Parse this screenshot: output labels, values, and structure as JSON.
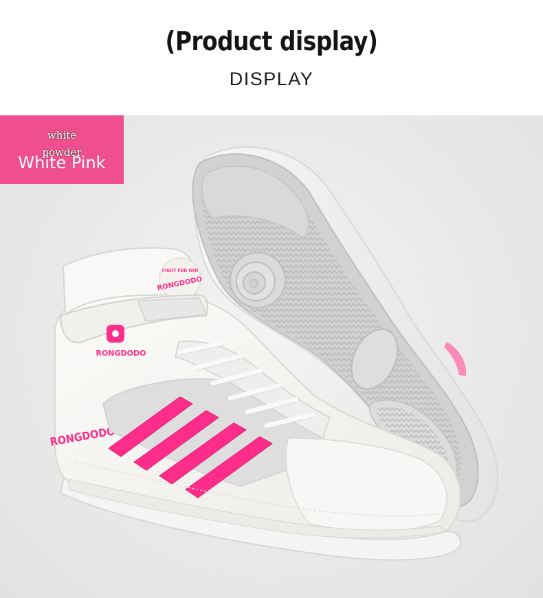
{
  "header": {
    "title": "(Product display)",
    "subtitle": "DISPLAY"
  },
  "badge": {
    "line1": "white",
    "line2": "powder",
    "label": "White Pink"
  },
  "product": {
    "brand": "RONGDODO",
    "collar_text": "FIGHT FOR WIN",
    "colors": {
      "accent_pink": "#ff2d8a",
      "upper_white": "#f6f5f2",
      "mesh_grey": "#dcdcdc",
      "sole_grey": "#c9c9c9"
    }
  }
}
